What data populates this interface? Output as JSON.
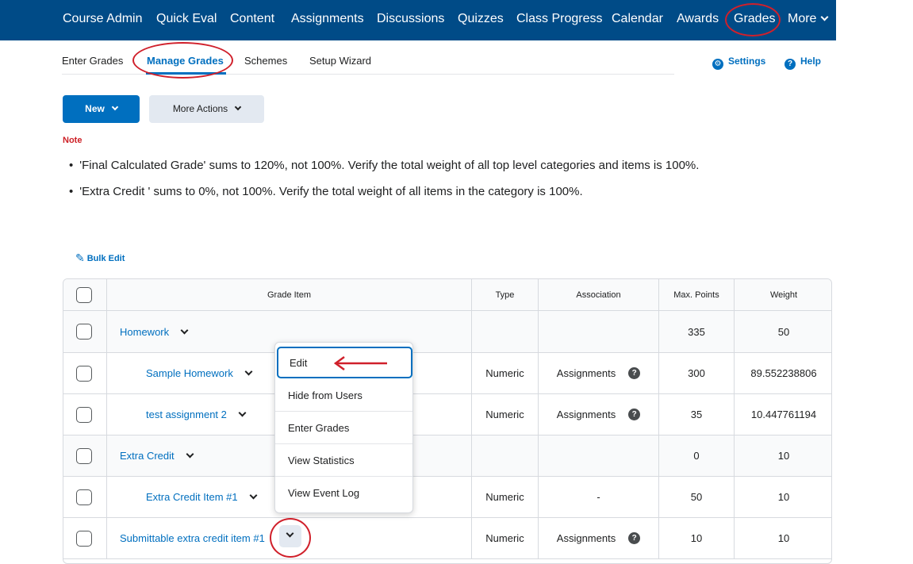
{
  "topnav": {
    "items": [
      "Course Admin",
      "Quick Eval",
      "Content",
      "Assignments",
      "Discussions",
      "Quizzes",
      "Class Progress",
      "Calendar",
      "Awards",
      "Grades"
    ],
    "more_label": "More"
  },
  "subtabs": {
    "items": [
      "Enter Grades",
      "Manage Grades",
      "Schemes",
      "Setup Wizard"
    ],
    "active": "Manage Grades"
  },
  "utility": {
    "settings_label": "Settings",
    "help_label": "Help"
  },
  "toolbar": {
    "new_label": "New",
    "more_actions_label": "More Actions"
  },
  "note": {
    "label": "Note",
    "lines": [
      "'Final Calculated Grade' sums to 120%, not 100%. Verify the total weight of all top level categories and items is 100%.",
      "'Extra Credit ' sums to 0%, not 100%. Verify the total weight of all items in the category is 100%."
    ]
  },
  "bulk_edit_label": "Bulk Edit",
  "table": {
    "headers": {
      "item": "Grade Item",
      "type": "Type",
      "association": "Association",
      "max_points": "Max. Points",
      "weight": "Weight"
    },
    "rows": [
      {
        "name": "Homework",
        "type": "",
        "association": "",
        "max_points": "335",
        "weight": "50"
      },
      {
        "name": "Sample Homework",
        "type": "Numeric",
        "association": "Assignments",
        "max_points": "300",
        "weight": "89.552238806"
      },
      {
        "name": "test assignment 2",
        "type": "Numeric",
        "association": "Assignments",
        "max_points": "35",
        "weight": "10.447761194"
      },
      {
        "name": "Extra Credit",
        "type": "",
        "association": "",
        "max_points": "0",
        "weight": "10"
      },
      {
        "name": "Extra Credit Item #1",
        "type": "Numeric",
        "association": "-",
        "max_points": "50",
        "weight": "10"
      },
      {
        "name": "Submittable extra credit item #1",
        "type": "Numeric",
        "association": "Assignments",
        "max_points": "10",
        "weight": "10"
      }
    ]
  },
  "context_menu": {
    "items": [
      "Edit",
      "Hide from Users",
      "Enter Grades",
      "View Statistics",
      "View Event Log"
    ]
  },
  "colors": {
    "nav_bg": "#004b87",
    "link": "#006fbf",
    "annotation": "#d0202b"
  }
}
